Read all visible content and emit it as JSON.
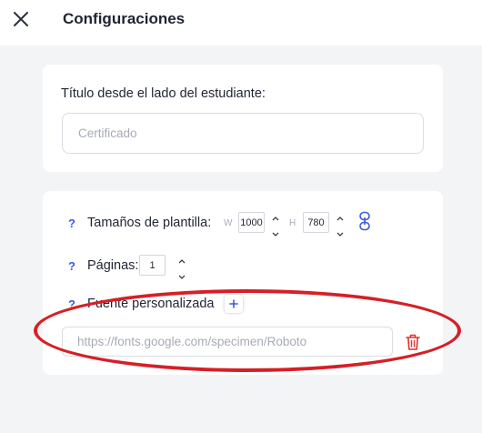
{
  "header": {
    "title": "Configuraciones",
    "close_icon": "close-icon"
  },
  "student_title": {
    "label": "Título desde el lado del estudiante:",
    "placeholder": "Certificado",
    "value": ""
  },
  "template": {
    "help_mark": "?",
    "sizes_label": "Tamaños de plantilla:",
    "width_letter": "W",
    "width_value": "1000",
    "height_letter": "H",
    "height_value": "780",
    "link_icon": "link-icon",
    "pages_label": "Páginas:",
    "pages_value": "1",
    "font_label": "Fuente personalizada",
    "font_add_icon": "plus-icon",
    "font_url_placeholder": "https://fonts.google.com/specimen/Roboto",
    "font_url_value": "",
    "delete_icon": "trash-icon"
  },
  "colors": {
    "accent": "#3b5bdb",
    "danger": "#e03131",
    "annotation": "#d61f26",
    "background": "#f3f4f6"
  }
}
